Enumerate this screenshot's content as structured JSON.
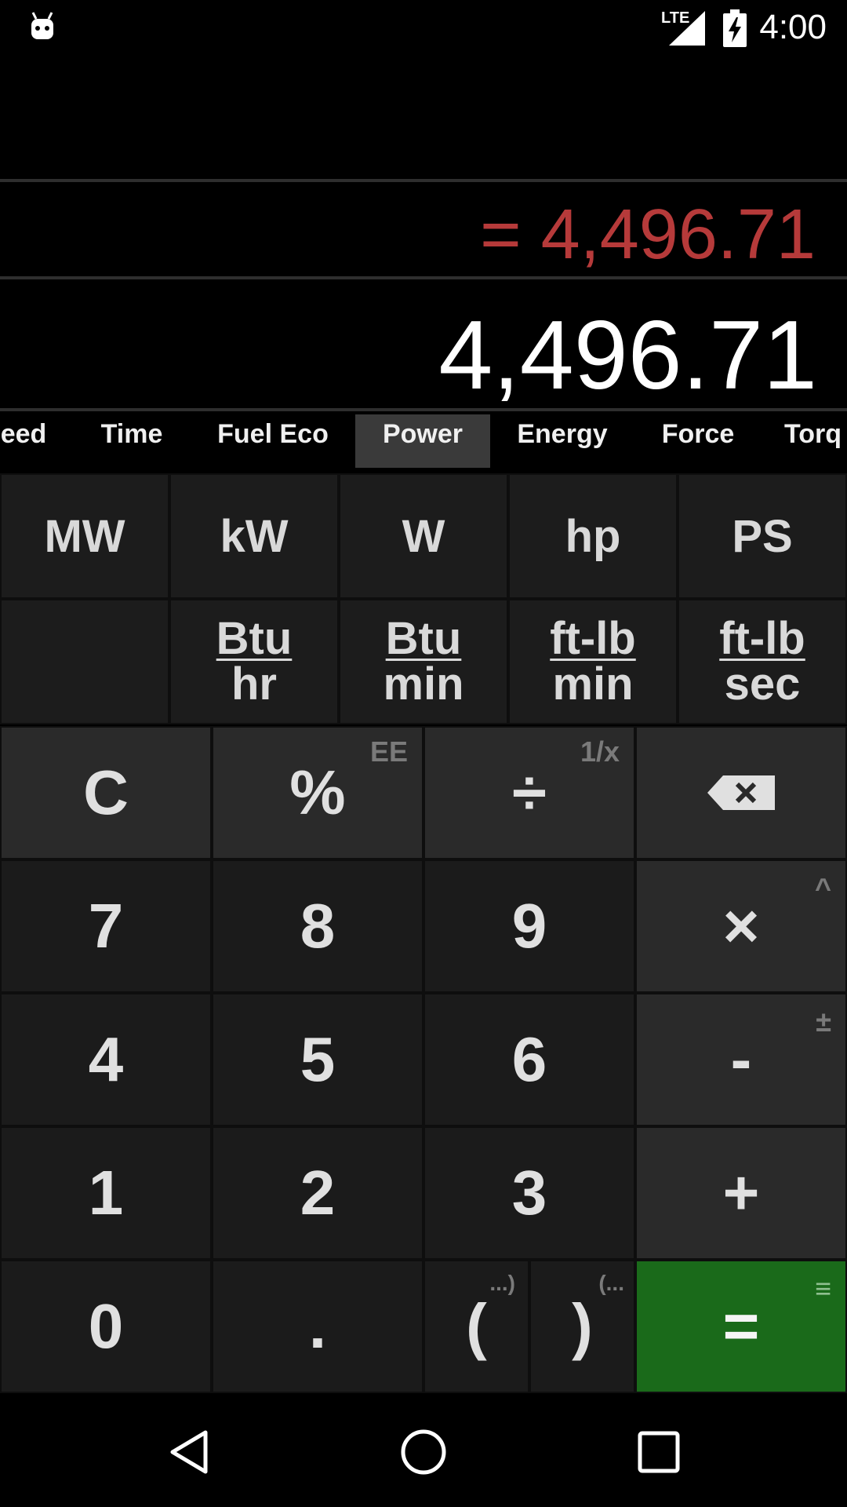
{
  "status_bar": {
    "network": "LTE",
    "time": "4:00"
  },
  "display": {
    "expression": "= 4,496.71",
    "result": "4,496.71"
  },
  "tabs": [
    {
      "label": "eed"
    },
    {
      "label": "Time"
    },
    {
      "label": "Fuel Eco"
    },
    {
      "label": "Power",
      "active": true
    },
    {
      "label": "Energy"
    },
    {
      "label": "Force"
    },
    {
      "label": "Torq"
    }
  ],
  "units": {
    "row1": [
      "MW",
      "kW",
      "W",
      "hp",
      "PS"
    ],
    "row2": [
      {
        "top": "Btu",
        "bottom": "hr"
      },
      {
        "top": "Btu",
        "bottom": "min"
      },
      {
        "top": "ft-lb",
        "bottom": "min"
      },
      {
        "top": "ft-lb",
        "bottom": "sec"
      }
    ]
  },
  "keypad": {
    "clear": "C",
    "percent": "%",
    "percent_sub": "EE",
    "divide": "÷",
    "divide_sub": "1/x",
    "seven": "7",
    "eight": "8",
    "nine": "9",
    "multiply": "×",
    "multiply_sub": "^",
    "four": "4",
    "five": "5",
    "six": "6",
    "minus": "-",
    "minus_sub": "±",
    "one": "1",
    "two": "2",
    "three": "3",
    "plus": "+",
    "zero": "0",
    "dot": ".",
    "open_paren": "(",
    "open_paren_sub": "...)",
    "close_paren": ")",
    "close_paren_sub": "(...",
    "equals": "=",
    "equals_sub": "≡"
  },
  "colors": {
    "expression": "#b63a3a",
    "equals_key": "#1a6a1a",
    "active_tab": "#3a3a3a"
  }
}
